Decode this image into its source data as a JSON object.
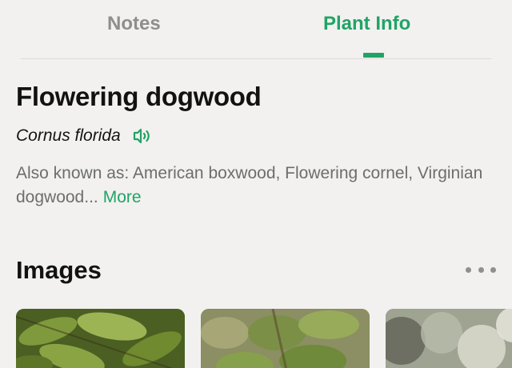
{
  "tabs": {
    "notes_label": "Notes",
    "plant_info_label": "Plant Info",
    "active": "Plant Info"
  },
  "plant": {
    "common_name": "Flowering dogwood",
    "scientific_name": "Cornus florida",
    "also_known_as": "Also known as: American boxwood, Flowering cornel, Virginian dogwood...",
    "more_label": "More"
  },
  "images_section": {
    "title": "Images",
    "more_icon": "ellipsis-icon",
    "thumbnails": [
      {
        "alt": "dogwood leaves photo"
      },
      {
        "alt": "dogwood leaves close-up photo"
      },
      {
        "alt": "dogwood blossoms blurred photo"
      }
    ]
  },
  "icons": {
    "pronunciation": "speaker-icon"
  },
  "colors": {
    "accent": "#21a366",
    "background": "#f2f1f0",
    "muted_text": "#6d6d6d",
    "inactive_tab": "#8e8e8e"
  }
}
